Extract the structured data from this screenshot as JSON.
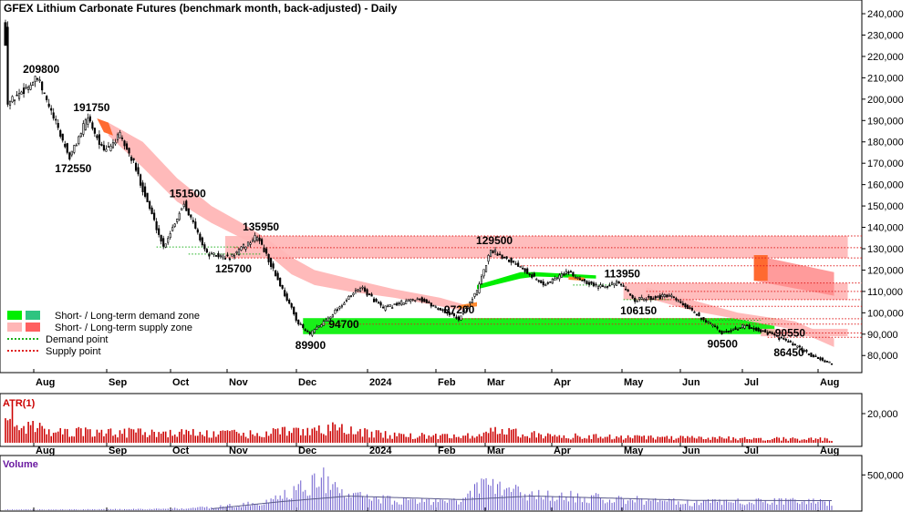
{
  "chart_data": [
    {
      "panel": "price",
      "type": "candlestick",
      "title": "GFEX Lithium Carbonate Futures (benchmark month, back-adjusted) - Daily",
      "y_ticks": [
        "240,000",
        "230,000",
        "220,000",
        "210,000",
        "200,000",
        "190,000",
        "180,000",
        "170,000",
        "160,000",
        "150,000",
        "140,000",
        "130,000",
        "120,000",
        "110,000",
        "100,000",
        "90,000",
        "80,000"
      ],
      "ylim": [
        72000,
        243000
      ],
      "x_labels": [
        "Aug",
        "Sep",
        "Oct",
        "Nov",
        "Dec",
        "2024",
        "Feb",
        "Mar",
        "Apr",
        "May",
        "Jun",
        "Jul",
        "Aug"
      ],
      "price_path": [
        {
          "day": 0,
          "value": 235000
        },
        {
          "day": 1,
          "value": 198000
        },
        {
          "day": 14,
          "value": 209800
        },
        {
          "day": 28,
          "value": 172550
        },
        {
          "day": 36,
          "value": 191750
        },
        {
          "day": 43,
          "value": 175000
        },
        {
          "day": 50,
          "value": 183000
        },
        {
          "day": 56,
          "value": 170000
        },
        {
          "day": 69,
          "value": 130800
        },
        {
          "day": 78,
          "value": 151500
        },
        {
          "day": 88,
          "value": 127500
        },
        {
          "day": 98,
          "value": 125700
        },
        {
          "day": 110,
          "value": 135950
        },
        {
          "day": 128,
          "value": 95000
        },
        {
          "day": 133,
          "value": 89900
        },
        {
          "day": 138,
          "value": 94700
        },
        {
          "day": 155,
          "value": 112000
        },
        {
          "day": 165,
          "value": 102000
        },
        {
          "day": 180,
          "value": 107000
        },
        {
          "day": 198,
          "value": 97200
        },
        {
          "day": 206,
          "value": 110000
        },
        {
          "day": 212,
          "value": 129500
        },
        {
          "day": 225,
          "value": 122000
        },
        {
          "day": 235,
          "value": 113000
        },
        {
          "day": 245,
          "value": 119000
        },
        {
          "day": 258,
          "value": 112500
        },
        {
          "day": 268,
          "value": 113950
        },
        {
          "day": 275,
          "value": 106150
        },
        {
          "day": 290,
          "value": 108000
        },
        {
          "day": 305,
          "value": 97000
        },
        {
          "day": 313,
          "value": 90500
        },
        {
          "day": 323,
          "value": 94000
        },
        {
          "day": 333,
          "value": 90550
        },
        {
          "day": 342,
          "value": 86450
        },
        {
          "day": 352,
          "value": 80000
        },
        {
          "day": 361,
          "value": 76000
        }
      ],
      "annotations": [
        {
          "label": "209800",
          "day": 14,
          "value": 209800,
          "pos": "above"
        },
        {
          "label": "191750",
          "day": 36,
          "value": 191750,
          "pos": "above"
        },
        {
          "label": "172550",
          "day": 28,
          "value": 172550,
          "pos": "below"
        },
        {
          "label": "151500",
          "day": 78,
          "value": 151500,
          "pos": "above"
        },
        {
          "label": "135950",
          "day": 110,
          "value": 135950,
          "pos": "above"
        },
        {
          "label": "125700",
          "day": 98,
          "value": 125700,
          "pos": "below"
        },
        {
          "label": "94700",
          "day": 138,
          "value": 94700,
          "pos": "right"
        },
        {
          "label": "89900",
          "day": 133,
          "value": 89900,
          "pos": "below"
        },
        {
          "label": "97200",
          "day": 198,
          "value": 97200,
          "pos": "above"
        },
        {
          "label": "129500",
          "day": 212,
          "value": 129500,
          "pos": "above"
        },
        {
          "label": "113950",
          "day": 268,
          "value": 113950,
          "pos": "above"
        },
        {
          "label": "106150",
          "day": 275,
          "value": 106150,
          "pos": "below"
        },
        {
          "label": "90500",
          "day": 313,
          "value": 90500,
          "pos": "below"
        },
        {
          "label": "90550",
          "day": 333,
          "value": 90550,
          "pos": "right"
        },
        {
          "label": "86450",
          "day": 342,
          "value": 86450,
          "pos": "below"
        }
      ],
      "zones": [
        {
          "kind": "short-term demand zone",
          "color": "#00ee00",
          "day_start": 130,
          "day_end": 336,
          "low": 90000,
          "high": 97500
        },
        {
          "kind": "short-term supply zone",
          "color": "#ffb6b6",
          "day_start": 96,
          "day_end": 368,
          "low": 125700,
          "high": 135950
        },
        {
          "kind": "short-term supply zone",
          "color": "#ffb6b6",
          "day_start": 270,
          "day_end": 368,
          "low": 106150,
          "high": 113950
        },
        {
          "kind": "short-term supply zone",
          "color": "#ffb6b6",
          "day_start": 330,
          "day_end": 368,
          "low": 89000,
          "high": 92500
        },
        {
          "kind": "long-term supply zone",
          "color": "#ff7a40",
          "day_start": 327,
          "day_end": 333,
          "low": 115000,
          "high": 127000
        }
      ],
      "supply_band": [
        {
          "day": 45,
          "lo": 183000,
          "hi": 189000
        },
        {
          "day": 60,
          "lo": 168000,
          "hi": 180000
        },
        {
          "day": 75,
          "lo": 152000,
          "hi": 163000
        },
        {
          "day": 90,
          "lo": 142000,
          "hi": 150000
        },
        {
          "day": 105,
          "lo": 134000,
          "hi": 141000
        },
        {
          "day": 115,
          "lo": 127000,
          "hi": 134000
        },
        {
          "day": 125,
          "lo": 118000,
          "hi": 126000
        },
        {
          "day": 135,
          "lo": 113000,
          "hi": 120000
        },
        {
          "day": 150,
          "lo": 110000,
          "hi": 116000
        },
        {
          "day": 170,
          "lo": 107000,
          "hi": 111000
        },
        {
          "day": 190,
          "lo": 103000,
          "hi": 107000
        },
        {
          "day": 200,
          "lo": 101000,
          "hi": 104000
        },
        {
          "day": 280,
          "lo": 107000,
          "hi": 112000
        },
        {
          "day": 300,
          "lo": 101000,
          "hi": 106000
        },
        {
          "day": 320,
          "lo": 97000,
          "hi": 100000
        },
        {
          "day": 345,
          "lo": 92000,
          "hi": 96000
        },
        {
          "day": 362,
          "lo": 84000,
          "hi": 88000
        }
      ],
      "demand_band": [
        {
          "day": 206,
          "lo": 111000,
          "hi": 113000
        },
        {
          "day": 225,
          "lo": 116000,
          "hi": 119000
        },
        {
          "day": 232,
          "lo": 117000,
          "hi": 119000
        },
        {
          "day": 258,
          "lo": 116000,
          "hi": 117500
        }
      ],
      "demand_points": [
        {
          "value": 130800,
          "day_start": 66,
          "day_end": 102
        },
        {
          "value": 127500,
          "day_start": 80,
          "day_end": 112
        },
        {
          "value": 113000,
          "day_start": 248,
          "day_end": 265
        },
        {
          "value": 106150,
          "day_start": 270,
          "day_end": 290
        },
        {
          "value": 96500,
          "day_start": 306,
          "day_end": 330
        }
      ],
      "supply_points": [
        {
          "value": 135950,
          "day_start": 110,
          "day_end": 368
        },
        {
          "value": 130500,
          "day_start": 100,
          "day_end": 368
        },
        {
          "value": 125700,
          "day_start": 96,
          "day_end": 368
        },
        {
          "value": 122000,
          "day_start": 225,
          "day_end": 368
        },
        {
          "value": 113950,
          "day_start": 268,
          "day_end": 368
        },
        {
          "value": 110000,
          "day_start": 280,
          "day_end": 368
        },
        {
          "value": 106150,
          "day_start": 275,
          "day_end": 368
        },
        {
          "value": 103000,
          "day_start": 290,
          "day_end": 368
        },
        {
          "value": 97200,
          "day_start": 198,
          "day_end": 368
        },
        {
          "value": 94700,
          "day_start": 138,
          "day_end": 368
        },
        {
          "value": 90550,
          "day_start": 333,
          "day_end": 368
        },
        {
          "value": 88500,
          "day_start": 333,
          "day_end": 368
        }
      ],
      "legend": [
        {
          "label": "Short- / Long-term demand zone",
          "colors": [
            "#00ee00",
            "#2ec480"
          ]
        },
        {
          "label": "Short- / Long-term supply zone",
          "colors": [
            "#ffb6b6",
            "#ff6060"
          ]
        },
        {
          "label": "Demand point",
          "style": "green-dotted"
        },
        {
          "label": "Supply point",
          "style": "red-dotted"
        }
      ]
    },
    {
      "panel": "atr",
      "type": "bar",
      "title": "ATR(1)",
      "y_ticks": [
        "20,000"
      ],
      "ylim": [
        0,
        30000
      ],
      "x_labels": [
        "Aug",
        "Sep",
        "Oct",
        "Nov",
        "Dec",
        "2024",
        "Feb",
        "Mar",
        "Apr",
        "May",
        "Jun",
        "Jul",
        "Aug"
      ],
      "level_path": [
        {
          "day": 0,
          "value": 26000
        },
        {
          "day": 5,
          "value": 14000
        },
        {
          "day": 20,
          "value": 8500
        },
        {
          "day": 60,
          "value": 7500
        },
        {
          "day": 110,
          "value": 6500
        },
        {
          "day": 140,
          "value": 11000
        },
        {
          "day": 170,
          "value": 5500
        },
        {
          "day": 200,
          "value": 4500
        },
        {
          "day": 212,
          "value": 9000
        },
        {
          "day": 240,
          "value": 5000
        },
        {
          "day": 300,
          "value": 3500
        },
        {
          "day": 361,
          "value": 2800
        }
      ]
    },
    {
      "panel": "volume",
      "type": "bar",
      "title": "Volume",
      "y_ticks": [
        "500,000"
      ],
      "ylim": [
        0,
        620000
      ],
      "x_labels": [
        "Aug",
        "Sep",
        "Oct",
        "Nov",
        "Dec",
        "2024",
        "Feb",
        "Mar",
        "Apr",
        "May",
        "Jun",
        "Jul",
        "Aug"
      ],
      "level_path": [
        {
          "day": 0,
          "value": 8000
        },
        {
          "day": 60,
          "value": 15000
        },
        {
          "day": 90,
          "value": 40000
        },
        {
          "day": 110,
          "value": 100000
        },
        {
          "day": 125,
          "value": 250000
        },
        {
          "day": 138,
          "value": 500000
        },
        {
          "day": 150,
          "value": 200000
        },
        {
          "day": 180,
          "value": 120000
        },
        {
          "day": 198,
          "value": 130000
        },
        {
          "day": 210,
          "value": 380000
        },
        {
          "day": 225,
          "value": 250000
        },
        {
          "day": 260,
          "value": 170000
        },
        {
          "day": 300,
          "value": 110000
        },
        {
          "day": 340,
          "value": 130000
        },
        {
          "day": 361,
          "value": 120000
        }
      ],
      "avg_path": [
        {
          "day": 90,
          "value": 20000
        },
        {
          "day": 120,
          "value": 120000
        },
        {
          "day": 150,
          "value": 200000
        },
        {
          "day": 200,
          "value": 150000
        },
        {
          "day": 230,
          "value": 200000
        },
        {
          "day": 300,
          "value": 140000
        },
        {
          "day": 361,
          "value": 135000
        }
      ]
    }
  ],
  "colors": {
    "candle_up": "#ffffff",
    "candle_down": "#000000",
    "atr_bar": "#cc0000",
    "volume_bar": "#6a5acd",
    "volume_avg": "#5a5a8a",
    "demand_zone": "#00ee00",
    "supply_zone": "#ffb6b6",
    "long_supply": "#ff6a30",
    "demand_line": "#1db01d",
    "supply_line": "#e02020",
    "atr_title": "#cc0000",
    "volume_title": "#6a1aa0"
  }
}
